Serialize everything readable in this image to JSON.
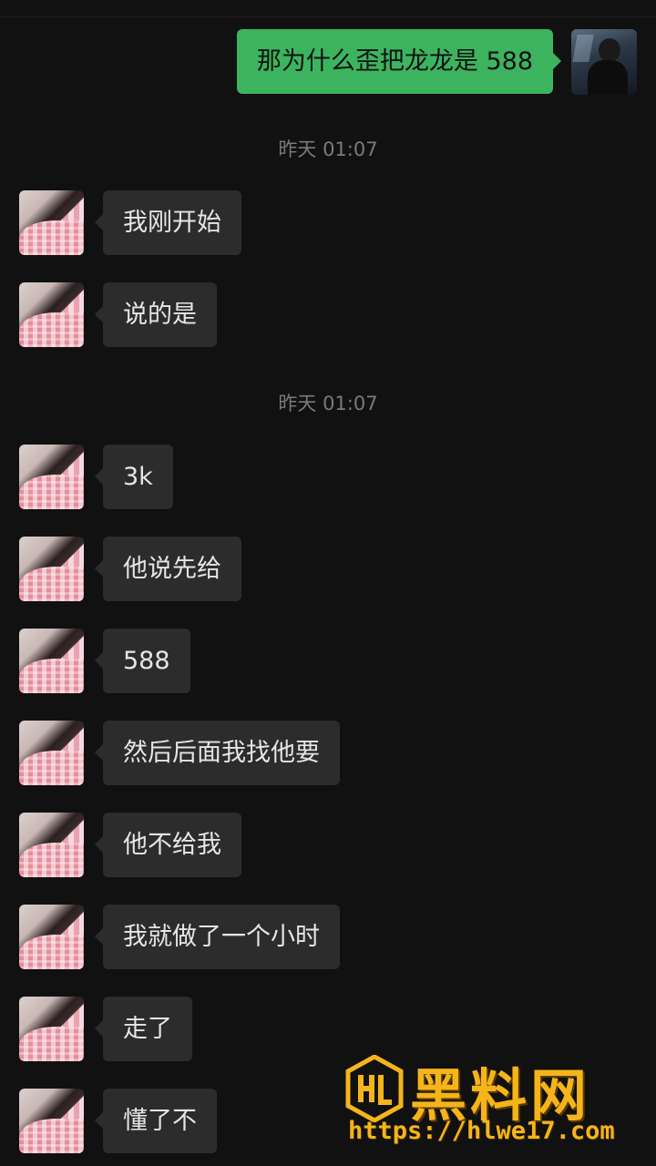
{
  "conversation": {
    "sent": [
      {
        "text": "那为什么歪把龙龙是 588"
      }
    ],
    "timestamps": [
      {
        "text": "昨天 01:07"
      },
      {
        "text": "昨天 01:07"
      }
    ],
    "received": [
      {
        "text": "我刚开始"
      },
      {
        "text": "说的是"
      },
      {
        "text": "3k"
      },
      {
        "text": "他说先给"
      },
      {
        "text": "588"
      },
      {
        "text": "然后后面我找他要"
      },
      {
        "text": "他不给我"
      },
      {
        "text": "我就做了一个小时"
      },
      {
        "text": "走了"
      },
      {
        "text": "懂了不"
      }
    ]
  },
  "watermark": {
    "title": "黑料网",
    "url": "https://hlwe17.com",
    "color": "#f5b41a"
  },
  "colors": {
    "background": "#111111",
    "sent_bubble": "#3cb45f",
    "received_bubble": "#2c2c2c",
    "timestamp": "#7a7a7a"
  }
}
